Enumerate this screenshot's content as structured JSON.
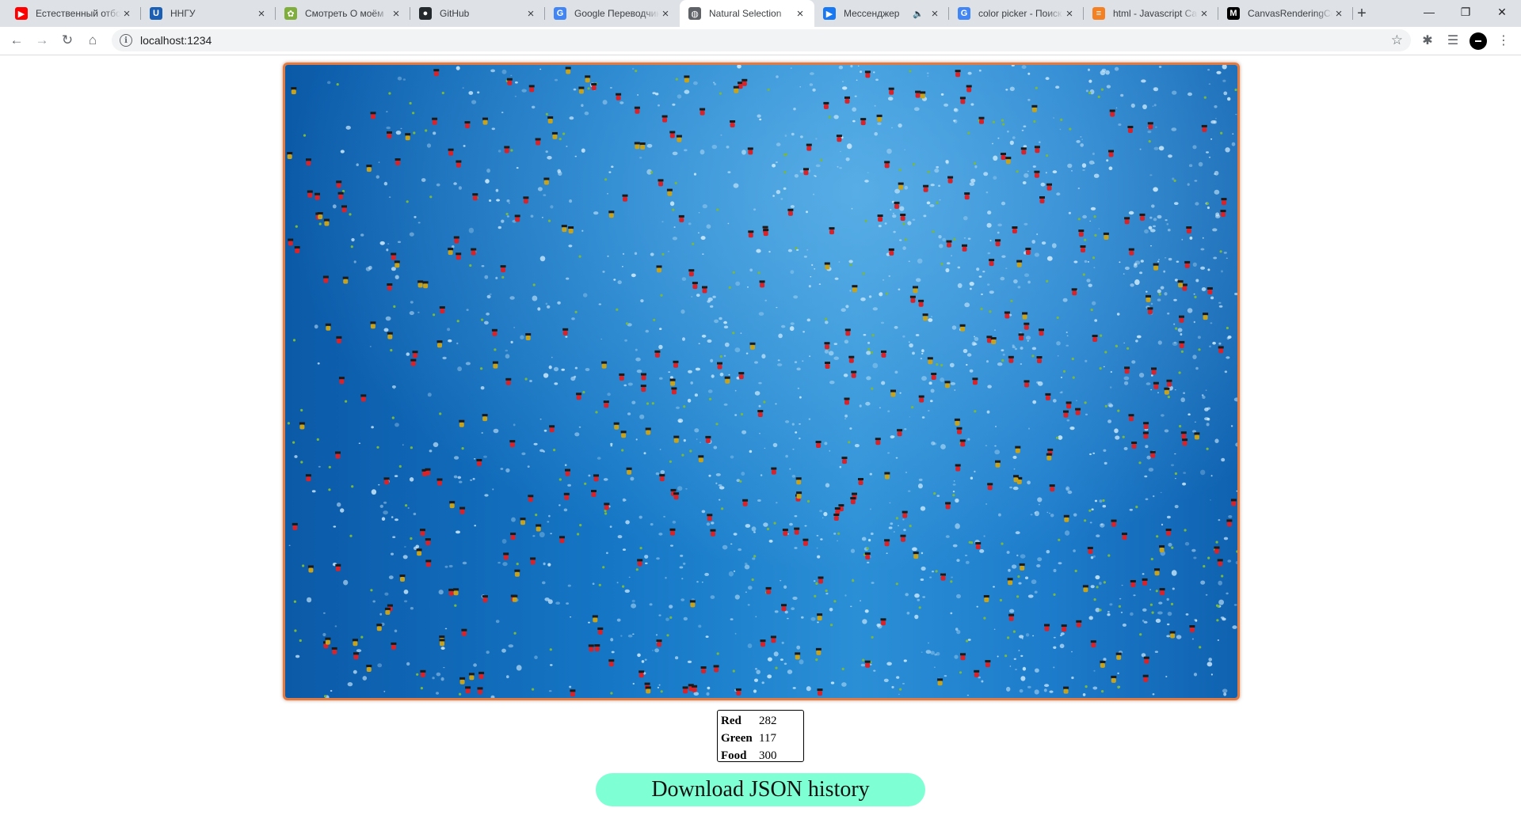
{
  "browser": {
    "tabs": [
      {
        "title": "Естественный отбор",
        "icon": "youtube-icon",
        "color": "#ff0000",
        "glyph": "▶",
        "active": false,
        "audio": false
      },
      {
        "title": "ННГУ",
        "icon": "unn-icon",
        "color": "#1a5fb4",
        "glyph": "U",
        "active": false,
        "audio": false
      },
      {
        "title": "Смотреть О моём",
        "icon": "anime-site-icon",
        "color": "#7fae3c",
        "glyph": "✿",
        "active": false,
        "audio": false
      },
      {
        "title": "GitHub",
        "icon": "github-icon",
        "color": "#24292e",
        "glyph": "●",
        "active": false,
        "audio": false
      },
      {
        "title": "Google Переводчик",
        "icon": "google-translate-icon",
        "color": "#4285f4",
        "glyph": "G",
        "active": false,
        "audio": false
      },
      {
        "title": "Natural Selection",
        "icon": "globe-icon",
        "color": "#5f6368",
        "glyph": "◍",
        "active": true,
        "audio": false
      },
      {
        "title": "Мессенджер",
        "icon": "messenger-icon",
        "color": "#1877f2",
        "glyph": "▶",
        "active": false,
        "audio": true
      },
      {
        "title": "color picker - Поиск",
        "icon": "google-icon",
        "color": "#4285f4",
        "glyph": "G",
        "active": false,
        "audio": false
      },
      {
        "title": "html - Javascript Ca",
        "icon": "stackoverflow-icon",
        "color": "#f48024",
        "glyph": "≡",
        "active": false,
        "audio": false
      },
      {
        "title": "CanvasRenderingCo",
        "icon": "mdn-icon",
        "color": "#000000",
        "glyph": "M",
        "active": false,
        "audio": false
      }
    ],
    "new_tab": "+",
    "window_controls": {
      "minimize": "—",
      "restore": "❐",
      "close": "✕"
    },
    "url": "localhost:1234"
  },
  "simulation": {
    "background_color": "#1273c4",
    "border_color": "#e27a42"
  },
  "stats": {
    "rows": [
      {
        "label": "Red",
        "value": "282"
      },
      {
        "label": "Green",
        "value": "117"
      },
      {
        "label": "Food",
        "value": "300"
      }
    ]
  },
  "download_button": {
    "label": "Download JSON history",
    "color": "#7fffd4"
  }
}
